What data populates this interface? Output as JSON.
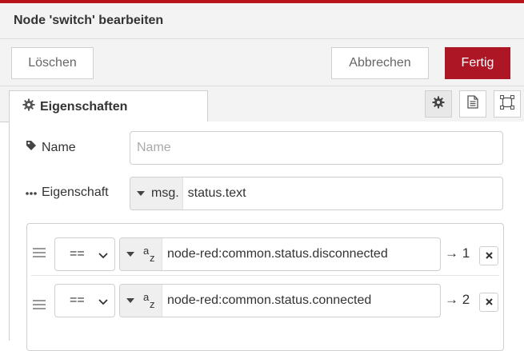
{
  "dialog": {
    "title": "Node 'switch' bearbeiten",
    "accent_color": "#ad1625"
  },
  "toolbar": {
    "delete_label": "Löschen",
    "cancel_label": "Abbrechen",
    "done_label": "Fertig"
  },
  "tabs": {
    "properties_label": "Eigenschaften",
    "icons": [
      "gear-icon",
      "document-icon",
      "frame-icon"
    ]
  },
  "form": {
    "name_label": "Name",
    "name_placeholder": "Name",
    "name_value": "",
    "property_label": "Eigenschaft",
    "property_type": "msg.",
    "property_value": "status.text"
  },
  "rules": [
    {
      "operator": "==",
      "value_type": "string",
      "value": "node-red:common.status.disconnected",
      "output": "→ 1"
    },
    {
      "operator": "==",
      "value_type": "string",
      "value": "node-red:common.status.connected",
      "output": "→ 2"
    }
  ]
}
